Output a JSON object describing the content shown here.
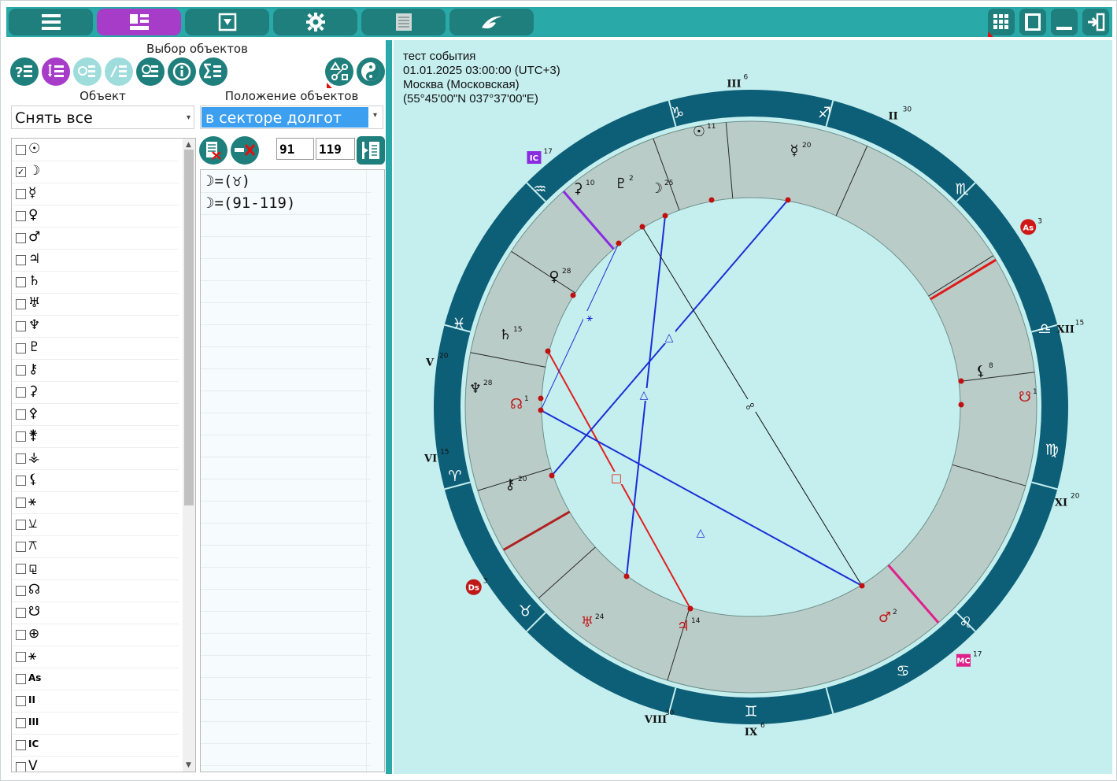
{
  "toolbar": {
    "tabs": [
      {
        "name": "menu",
        "icon": "list-icon"
      },
      {
        "name": "objects",
        "icon": "objects-icon",
        "active": true
      },
      {
        "name": "dropdown",
        "icon": "dropdown-icon"
      },
      {
        "name": "settings",
        "icon": "gear-icon"
      },
      {
        "name": "table",
        "icon": "table-icon"
      },
      {
        "name": "logo",
        "icon": "logo-icon"
      }
    ],
    "right_buttons": [
      "grid-icon",
      "panel-icon",
      "minimize-icon",
      "exit-icon"
    ]
  },
  "left_panel": {
    "title": "Выбор объектов",
    "object_label": "Объект",
    "position_label": "Положение объектов",
    "object_select": "Снять все",
    "position_select": "в секторе долгот",
    "range_from": "91",
    "range_to": "119",
    "objects": [
      {
        "glyph": "☉",
        "checked": false
      },
      {
        "glyph": "☽",
        "checked": true
      },
      {
        "glyph": "☿",
        "checked": false
      },
      {
        "glyph": "♀",
        "checked": false
      },
      {
        "glyph": "♂",
        "checked": false
      },
      {
        "glyph": "♃",
        "checked": false
      },
      {
        "glyph": "♄",
        "checked": false
      },
      {
        "glyph": "♅",
        "checked": false
      },
      {
        "glyph": "♆",
        "checked": false
      },
      {
        "glyph": "♇",
        "checked": false
      },
      {
        "glyph": "⚷",
        "checked": false
      },
      {
        "glyph": "⚳",
        "checked": false
      },
      {
        "glyph": "⚴",
        "checked": false
      },
      {
        "glyph": "⚵",
        "checked": false
      },
      {
        "glyph": "⚶",
        "checked": false
      },
      {
        "glyph": "⚸",
        "checked": false
      },
      {
        "glyph": "⚹",
        "checked": false
      },
      {
        "glyph": "⚺",
        "checked": false
      },
      {
        "glyph": "⚻",
        "checked": false
      },
      {
        "glyph": "⚼",
        "checked": false
      },
      {
        "glyph": "☊",
        "checked": false
      },
      {
        "glyph": "☋",
        "checked": false
      },
      {
        "glyph": "⊕",
        "checked": false
      },
      {
        "glyph": "⚹",
        "checked": false
      },
      {
        "glyph": "As",
        "checked": false
      },
      {
        "glyph": "II",
        "checked": false
      },
      {
        "glyph": "III",
        "checked": false
      },
      {
        "glyph": "IC",
        "checked": false
      },
      {
        "glyph": "V",
        "checked": false
      }
    ],
    "results": [
      "☽=(♉)",
      "☽=(91-119)"
    ]
  },
  "chart": {
    "info": [
      "тест события",
      "01.01.2025 03:00:00 (UTC+3)",
      "Москва (Московская)",
      "(55°45'00\"N 037°37'00\"E)"
    ],
    "signs": [
      "♈",
      "♉",
      "♊",
      "♋",
      "♌",
      "♍",
      "♎",
      "♏",
      "♐",
      "♑",
      "♒",
      "♓"
    ],
    "house_labels": [
      {
        "label": "IC",
        "deg": "17"
      },
      {
        "label": "As",
        "deg": "3"
      },
      {
        "label": "MC",
        "deg": "17"
      },
      {
        "label": "Ds",
        "deg": "3"
      },
      {
        "label": "II",
        "deg": "30"
      },
      {
        "label": "III",
        "deg": "6"
      },
      {
        "label": "V",
        "deg": "20"
      },
      {
        "label": "VI",
        "deg": "15"
      },
      {
        "label": "VIII",
        "deg": "30"
      },
      {
        "label": "IX",
        "deg": "6"
      },
      {
        "label": "XI",
        "deg": "20"
      },
      {
        "label": "XII",
        "deg": "15"
      }
    ],
    "planets": [
      {
        "glyph": "☉",
        "deg": "11"
      },
      {
        "glyph": "☿",
        "deg": "20"
      },
      {
        "glyph": "⚳",
        "deg": "10"
      },
      {
        "glyph": "♇",
        "deg": "2"
      },
      {
        "glyph": "☽",
        "deg": "25"
      },
      {
        "glyph": "♀",
        "deg": "28"
      },
      {
        "glyph": "♄",
        "deg": "15"
      },
      {
        "glyph": "♆",
        "deg": "28"
      },
      {
        "glyph": "☊",
        "deg": "1"
      },
      {
        "glyph": "⚷",
        "deg": "20"
      },
      {
        "glyph": "⚸",
        "deg": "8"
      },
      {
        "glyph": "☋",
        "deg": "1"
      },
      {
        "glyph": "♅",
        "deg": "24"
      },
      {
        "glyph": "♃",
        "deg": "14"
      },
      {
        "glyph": "♂",
        "deg": "2"
      }
    ],
    "colors": {
      "ring": "#0d5f78",
      "house_bg": "#b9ccc8",
      "bg": "#c5eeee",
      "aspect_red": "#e02020",
      "aspect_blue": "#1a2fd6"
    }
  }
}
